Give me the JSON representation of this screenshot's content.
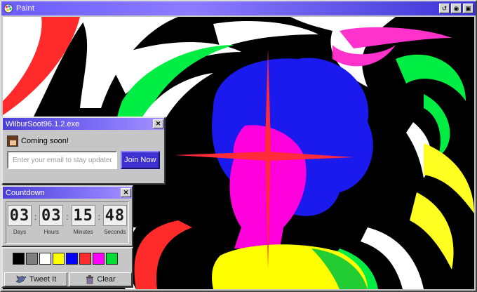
{
  "window": {
    "title": "Paint",
    "icon": "paint-palette-icon",
    "controls": [
      "restore-icon",
      "minimize-icon",
      "close-icon"
    ]
  },
  "signup": {
    "title": "WilburSoot96.1.2.exe",
    "close_label": "✕",
    "message": "Coming soon!",
    "email_placeholder": "Enter your email to stay updated",
    "join_label": "Join Now"
  },
  "countdown": {
    "title": "Countdown",
    "close_label": "✕",
    "units": [
      {
        "value": "03",
        "label": "Days"
      },
      {
        "value": "03",
        "label": "Hours"
      },
      {
        "value": "15",
        "label": "Minutes"
      },
      {
        "value": "48",
        "label": "Seconds"
      }
    ],
    "separator": ":"
  },
  "palette": {
    "colors": [
      "#000000",
      "#7f7f7f",
      "#ffffff",
      "#ffff00",
      "#0000ff",
      "#ff2d2d",
      "#ff00ff",
      "#00dd33"
    ],
    "tweet_label": "Tweet It",
    "clear_label": "Clear"
  }
}
